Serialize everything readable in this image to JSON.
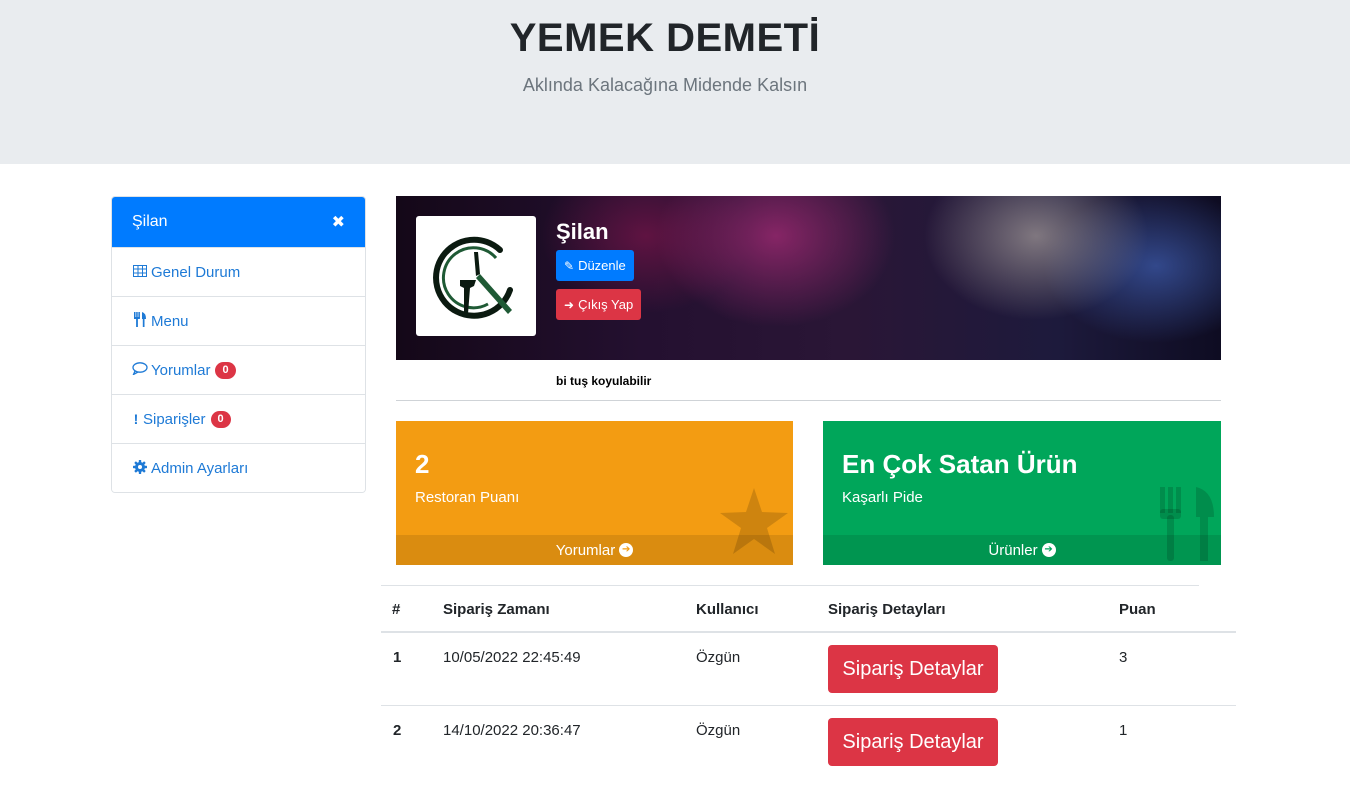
{
  "header": {
    "title": "YEMEK DEMETİ",
    "slogan": "Aklında Kalacağına Midende Kalsın"
  },
  "sidebar": {
    "title": "Şilan",
    "close_icon": "close-icon",
    "items": [
      {
        "label": "Genel Durum",
        "icon": "table-icon"
      },
      {
        "label": "Menu",
        "icon": "cutlery-icon"
      },
      {
        "label": "Yorumlar",
        "icon": "comment-icon",
        "badge": "0"
      },
      {
        "label": "Siparişler",
        "icon": "exclamation-icon",
        "badge": "0"
      },
      {
        "label": "Admin Ayarları",
        "icon": "gear-icon"
      }
    ]
  },
  "profile": {
    "name": "Şilan",
    "edit_label": "Düzenle",
    "logout_label": "Çıkış Yap",
    "note": "bi tuş koyulabilir"
  },
  "stats": {
    "rating": {
      "value": "2",
      "label": "Restoran Puanı",
      "link": "Yorumlar",
      "color": "#f39c12",
      "icon": "star-icon"
    },
    "best_seller": {
      "value": "En Çok Satan Ürün",
      "label": "Kaşarlı Pide",
      "link": "Ürünler",
      "color": "#00a65a",
      "icon": "cutlery-icon"
    }
  },
  "orders": {
    "columns": [
      "#",
      "Sipariş Zamanı",
      "Kullanıcı",
      "Sipariş Detayları",
      "Puan"
    ],
    "rows": [
      {
        "idx": "1",
        "time": "10/05/2022 22:45:49",
        "user": "Özgün",
        "detail_label": "Sipariş Detaylar",
        "score": "3"
      },
      {
        "idx": "2",
        "time": "14/10/2022 20:36:47",
        "user": "Özgün",
        "detail_label": "Sipariş Detaylar",
        "score": "1"
      }
    ]
  },
  "colors": {
    "primary": "#007bff",
    "danger": "#dc3545",
    "warning": "#f39c12",
    "success": "#00a65a"
  }
}
